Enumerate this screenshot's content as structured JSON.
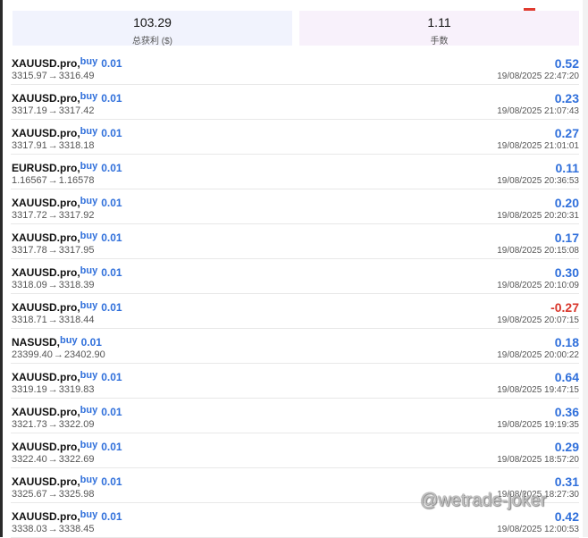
{
  "summary": {
    "total_profit_value": "103.29",
    "total_profit_label": "总获利 ($)",
    "lots_value": "1.11",
    "lots_label": "手数"
  },
  "trades": [
    {
      "symbol": "XAUUSD.pro,",
      "side": "buy",
      "volume": "0.01",
      "open_price": "3315.97",
      "close_price": "3316.49",
      "profit": "0.52",
      "time": "19/08/2025 22:47:20"
    },
    {
      "symbol": "XAUUSD.pro,",
      "side": "buy",
      "volume": "0.01",
      "open_price": "3317.19",
      "close_price": "3317.42",
      "profit": "0.23",
      "time": "19/08/2025 21:07:43"
    },
    {
      "symbol": "XAUUSD.pro,",
      "side": "buy",
      "volume": "0.01",
      "open_price": "3317.91",
      "close_price": "3318.18",
      "profit": "0.27",
      "time": "19/08/2025 21:01:01"
    },
    {
      "symbol": "EURUSD.pro,",
      "side": "buy",
      "volume": "0.01",
      "open_price": "1.16567",
      "close_price": "1.16578",
      "profit": "0.11",
      "time": "19/08/2025 20:36:53"
    },
    {
      "symbol": "XAUUSD.pro,",
      "side": "buy",
      "volume": "0.01",
      "open_price": "3317.72",
      "close_price": "3317.92",
      "profit": "0.20",
      "time": "19/08/2025 20:20:31"
    },
    {
      "symbol": "XAUUSD.pro,",
      "side": "buy",
      "volume": "0.01",
      "open_price": "3317.78",
      "close_price": "3317.95",
      "profit": "0.17",
      "time": "19/08/2025 20:15:08"
    },
    {
      "symbol": "XAUUSD.pro,",
      "side": "buy",
      "volume": "0.01",
      "open_price": "3318.09",
      "close_price": "3318.39",
      "profit": "0.30",
      "time": "19/08/2025 20:10:09"
    },
    {
      "symbol": "XAUUSD.pro,",
      "side": "buy",
      "volume": "0.01",
      "open_price": "3318.71",
      "close_price": "3318.44",
      "profit": "-0.27",
      "time": "19/08/2025 20:07:15"
    },
    {
      "symbol": "NASUSD,",
      "side": "buy",
      "volume": "0.01",
      "open_price": "23399.40",
      "close_price": "23402.90",
      "profit": "0.18",
      "time": "19/08/2025 20:00:22"
    },
    {
      "symbol": "XAUUSD.pro,",
      "side": "buy",
      "volume": "0.01",
      "open_price": "3319.19",
      "close_price": "3319.83",
      "profit": "0.64",
      "time": "19/08/2025 19:47:15"
    },
    {
      "symbol": "XAUUSD.pro,",
      "side": "buy",
      "volume": "0.01",
      "open_price": "3321.73",
      "close_price": "3322.09",
      "profit": "0.36",
      "time": "19/08/2025 19:19:35"
    },
    {
      "symbol": "XAUUSD.pro,",
      "side": "buy",
      "volume": "0.01",
      "open_price": "3322.40",
      "close_price": "3322.69",
      "profit": "0.29",
      "time": "19/08/2025 18:57:20"
    },
    {
      "symbol": "XAUUSD.pro,",
      "side": "buy",
      "volume": "0.01",
      "open_price": "3325.67",
      "close_price": "3325.98",
      "profit": "0.31",
      "time": "19/08/2025 18:27:30"
    },
    {
      "symbol": "XAUUSD.pro,",
      "side": "buy",
      "volume": "0.01",
      "open_price": "3338.03",
      "close_price": "3338.45",
      "profit": "0.42",
      "time": "19/08/2025 12:00:53"
    }
  ],
  "arrow_glyph": "→",
  "watermark": "@wetrade-joker",
  "colors": {
    "buy_blue": "#2f6fdb",
    "loss_red": "#d8352a",
    "profit_card_bg": "#f1f3fd",
    "lots_card_bg": "#f8f1fb"
  }
}
